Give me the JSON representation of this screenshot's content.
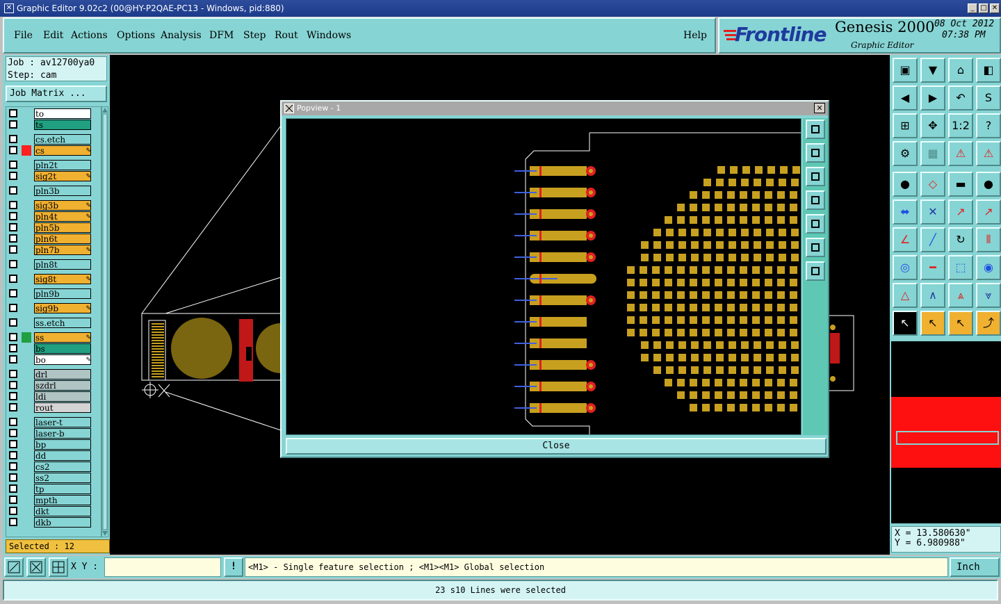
{
  "window": {
    "title": "Graphic Editor 9.02c2 (00@HY-P2QAE-PC13 - Windows, pid:880)",
    "icon": "app-icon",
    "controls": [
      "minimize-icon",
      "maximize-icon",
      "close-icon"
    ]
  },
  "menu": {
    "items": [
      "File",
      "Edit",
      "Actions",
      "Options",
      "Analysis",
      "DFM",
      "Step",
      "Rout",
      "Windows"
    ],
    "help": "Help"
  },
  "brand": {
    "logo": "Frontline",
    "product": "Genesis 2000",
    "subtitle": "Graphic Editor",
    "date": "08 Oct 2012",
    "time": "07:38 PM"
  },
  "job": {
    "job_line": "Job : av12700ya0",
    "step_line": "Step: cam",
    "matrix_button": "Job Matrix ..."
  },
  "layers": [
    {
      "name": "to",
      "color": "#ffffff",
      "mark": "",
      "editable": false
    },
    {
      "name": "ts",
      "color": "#20a080",
      "mark": "",
      "editable": false
    },
    {
      "name": "cs.etch",
      "color": "#87d4d4",
      "mark": "",
      "editable": false
    },
    {
      "name": "cs",
      "color": "#f0b030",
      "mark": "#ff2020",
      "editable": true
    },
    {
      "name": "pln2t",
      "color": "#87d4d4",
      "mark": "",
      "editable": false
    },
    {
      "name": "sig2t",
      "color": "#f0b030",
      "mark": "",
      "editable": true
    },
    {
      "name": "pln3b",
      "color": "#87d4d4",
      "mark": "",
      "editable": false
    },
    {
      "name": "sig3b",
      "color": "#f0b030",
      "mark": "",
      "editable": true
    },
    {
      "name": "pln4t",
      "color": "#f0b030",
      "mark": "",
      "editable": true
    },
    {
      "name": "pln5b",
      "color": "#f0b030",
      "mark": "",
      "editable": false
    },
    {
      "name": "pln6t",
      "color": "#f0b030",
      "mark": "",
      "editable": false
    },
    {
      "name": "pln7b",
      "color": "#f0b030",
      "mark": "",
      "editable": true
    },
    {
      "name": "pln8t",
      "color": "#87d4d4",
      "mark": "",
      "editable": false
    },
    {
      "name": "sig8t",
      "color": "#f0b030",
      "mark": "",
      "editable": true
    },
    {
      "name": "pln9b",
      "color": "#87d4d4",
      "mark": "",
      "editable": false
    },
    {
      "name": "sig9b",
      "color": "#f0b030",
      "mark": "",
      "editable": true
    },
    {
      "name": "ss.etch",
      "color": "#87d4d4",
      "mark": "",
      "editable": false
    },
    {
      "name": "ss",
      "color": "#f0b030",
      "mark": "#20a040",
      "editable": true
    },
    {
      "name": "bs",
      "color": "#20a080",
      "mark": "",
      "editable": false
    },
    {
      "name": "bo",
      "color": "#ffffff",
      "mark": "",
      "editable": true
    },
    {
      "name": "drl",
      "color": "#b0c4c4",
      "mark": "",
      "editable": false
    },
    {
      "name": "szdrl",
      "color": "#b0c4c4",
      "mark": "",
      "editable": false
    },
    {
      "name": "ldi",
      "color": "#b0c4c4",
      "mark": "",
      "editable": false
    },
    {
      "name": "rout",
      "color": "#d4d4d4",
      "mark": "",
      "editable": false
    },
    {
      "name": "laser-t",
      "color": "#87d4d4",
      "mark": "",
      "editable": false
    },
    {
      "name": "laser-b",
      "color": "#87d4d4",
      "mark": "",
      "editable": false
    },
    {
      "name": "bp",
      "color": "#87d4d4",
      "mark": "",
      "editable": false
    },
    {
      "name": "dd",
      "color": "#87d4d4",
      "mark": "",
      "editable": false
    },
    {
      "name": "cs2",
      "color": "#87d4d4",
      "mark": "",
      "editable": false
    },
    {
      "name": "ss2",
      "color": "#87d4d4",
      "mark": "",
      "editable": false
    },
    {
      "name": "tp",
      "color": "#87d4d4",
      "mark": "",
      "editable": false
    },
    {
      "name": "mpth",
      "color": "#87d4d4",
      "mark": "",
      "editable": false
    },
    {
      "name": "dkt",
      "color": "#87d4d4",
      "mark": "",
      "editable": false
    },
    {
      "name": "dkb",
      "color": "#87d4d4",
      "mark": "",
      "editable": false
    }
  ],
  "selected_status": "Selected : 12",
  "popview": {
    "title": "Popview - 1",
    "close_button": "Close"
  },
  "coords": {
    "x": "X = 13.580630\"",
    "y": "Y = 6.980988\""
  },
  "command": {
    "xy_label": "X Y :",
    "xy_value": "",
    "bang": "!",
    "prompt": "<M1> - Single feature selection ; <M1><M1> Global selection",
    "units": "Inch"
  },
  "status": "23 s10 Lines were selected",
  "colors": {
    "copper": "#c8a020",
    "pad_red": "#e02020",
    "line_blue": "#4060e0",
    "panel_teal": "#87d4d4"
  }
}
